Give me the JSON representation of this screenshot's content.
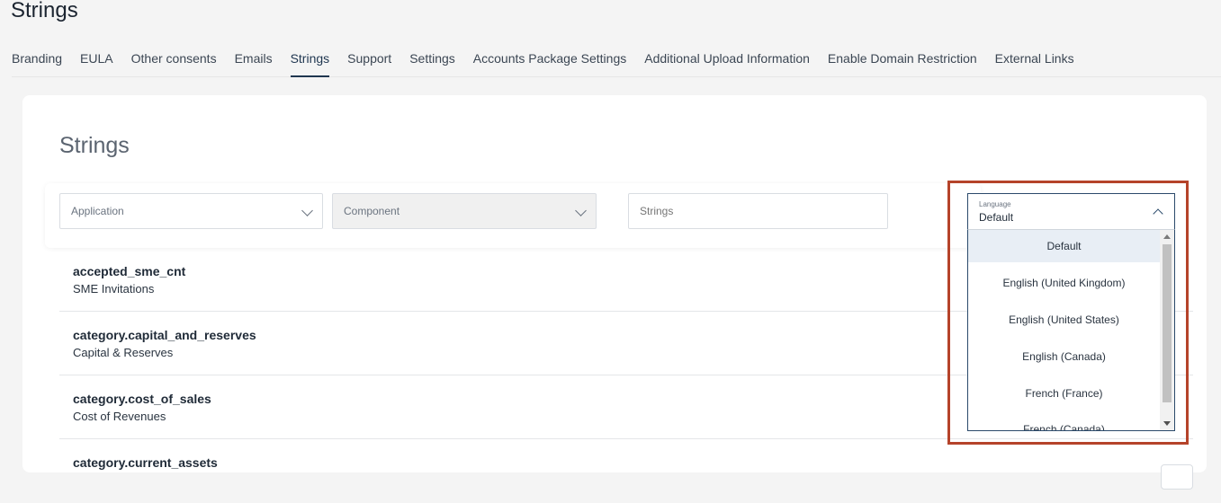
{
  "header": {
    "title": "Strings"
  },
  "tabs": [
    {
      "label": "Branding",
      "active": false
    },
    {
      "label": "EULA",
      "active": false
    },
    {
      "label": "Other consents",
      "active": false
    },
    {
      "label": "Emails",
      "active": false
    },
    {
      "label": "Strings",
      "active": true
    },
    {
      "label": "Support",
      "active": false
    },
    {
      "label": "Settings",
      "active": false
    },
    {
      "label": "Accounts Package Settings",
      "active": false
    },
    {
      "label": "Additional Upload Information",
      "active": false
    },
    {
      "label": "Enable Domain Restriction",
      "active": false
    },
    {
      "label": "External Links",
      "active": false
    }
  ],
  "card": {
    "title": "Strings"
  },
  "filters": {
    "application_placeholder": "Application",
    "component_placeholder": "Component",
    "strings_placeholder": "Strings"
  },
  "language": {
    "label": "Language",
    "value": "Default",
    "options": [
      "Default",
      "English (United Kingdom)",
      "English (United States)",
      "English (Canada)",
      "French (France)",
      "French (Canada)"
    ]
  },
  "rows": [
    {
      "key": "accepted_sme_cnt",
      "value": "SME Invitations"
    },
    {
      "key": "category.capital_and_reserves",
      "value": "Capital & Reserves"
    },
    {
      "key": "category.cost_of_sales",
      "value": "Cost of Revenues"
    },
    {
      "key": "category.current_assets",
      "value": ""
    }
  ],
  "colors": {
    "accent": "#1f3650",
    "highlight": "#b5432a"
  }
}
